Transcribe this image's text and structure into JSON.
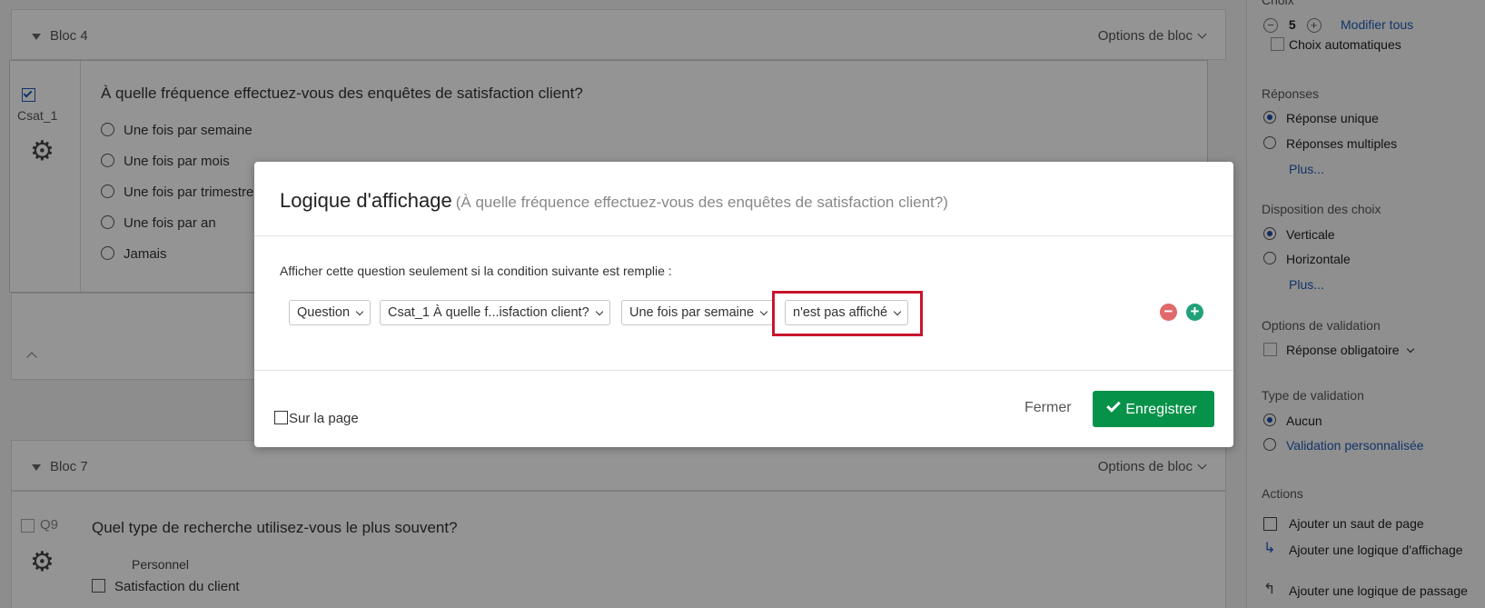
{
  "block4": {
    "title": "Bloc 4",
    "options": "Options de bloc"
  },
  "q_csat": {
    "id": "Csat_1",
    "text": "À quelle fréquence effectuez-vous des enquêtes de satisfaction client?",
    "options": [
      "Une fois par semaine",
      "Une fois par mois",
      "Une fois par trimestre",
      "Une fois par an",
      "Jamais"
    ]
  },
  "block7": {
    "title": "Bloc 7",
    "options": "Options de bloc"
  },
  "q9": {
    "id": "Q9",
    "text": "Quel type de recherche utilisez-vous le plus souvent?",
    "column_header": "Personnel",
    "options": [
      "Satisfaction du client"
    ]
  },
  "right_panel": {
    "choix_title": "Choix",
    "choix_count": "5",
    "modifier_tous": "Modifier tous",
    "choix_auto": "Choix automatiques",
    "reponses_title": "Réponses",
    "reponse_unique": "Réponse unique",
    "reponses_multiples": "Réponses multiples",
    "plus1": "Plus...",
    "disposition_title": "Disposition des choix",
    "verticale": "Verticale",
    "horizontale": "Horizontale",
    "plus2": "Plus...",
    "validation_title": "Options de validation",
    "reponse_obligatoire": "Réponse obligatoire",
    "type_validation_title": "Type de validation",
    "aucun": "Aucun",
    "validation_perso": "Validation personnalisée",
    "actions_title": "Actions",
    "saut_page": "Ajouter un saut de page",
    "logique_affichage": "Ajouter une logique d'affichage",
    "logique_passage": "Ajouter une logique de passage"
  },
  "modal": {
    "title": "Logique d'affichage",
    "subtitle": "(À quelle fréquence effectuez-vous des enquêtes de satisfaction client?)",
    "condition_label": "Afficher cette question seulement si la condition suivante est remplie :",
    "sel_type": "Question",
    "sel_question": "Csat_1 À quelle f...isfaction client?",
    "sel_choice": "Une fois par semaine",
    "sel_operator": "n'est pas affiché",
    "on_page": "Sur la page",
    "close": "Fermer",
    "save": "Enregistrer"
  },
  "colors": {
    "save_green": "#07924a",
    "highlight_red": "#c8152d",
    "link_blue": "#1f5bb5"
  }
}
